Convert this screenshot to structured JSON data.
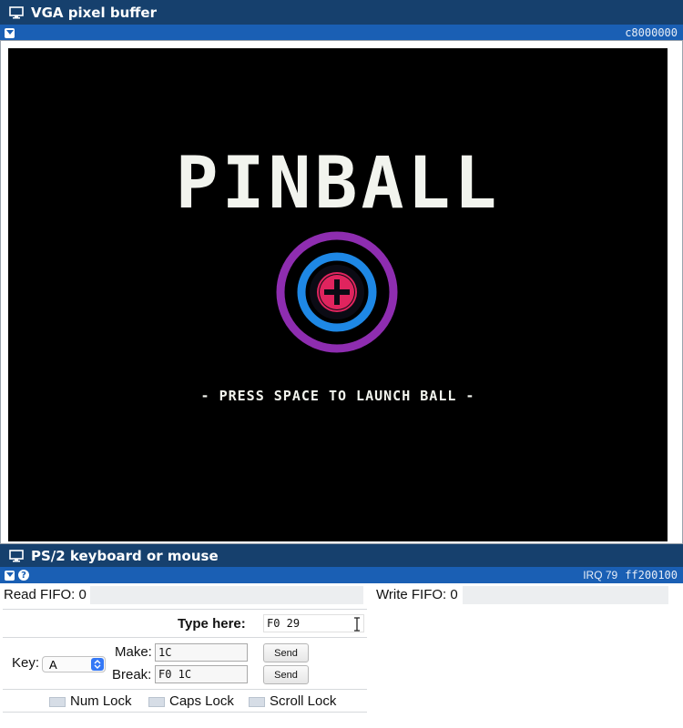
{
  "vga": {
    "title": "VGA pixel buffer",
    "address": "c8000000",
    "screen": {
      "title": "PINBALL",
      "prompt": "- PRESS SPACE TO LAUNCH BALL -"
    }
  },
  "ps2": {
    "title": "PS/2 keyboard or mouse",
    "irq": "IRQ 79",
    "address": "ff200100",
    "read_fifo_label": "Read FIFO: 0",
    "write_fifo_label": "Write FIFO: 0",
    "type_here_label": "Type here:",
    "type_here_value": "F0 29",
    "key_label": "Key:",
    "key_value": "A",
    "make_label": "Make:",
    "make_value": "1C",
    "break_label": "Break:",
    "break_value": "F0 1C",
    "send_label": "Send",
    "num_lock": "Num Lock",
    "caps_lock": "Caps Lock",
    "scroll_lock": "Scroll Lock"
  },
  "colors": {
    "titlebar": "#16406d",
    "subbar": "#1a5fb4",
    "ring_outer": "#8e2db0",
    "ring_inner": "#1e88e5",
    "cross": "#e0245e",
    "screen_text": "#f2f4ee"
  },
  "icons": [
    "monitor-icon",
    "collapse-icon",
    "help-icon",
    "chevron-updown-icon",
    "text-cursor-icon"
  ]
}
